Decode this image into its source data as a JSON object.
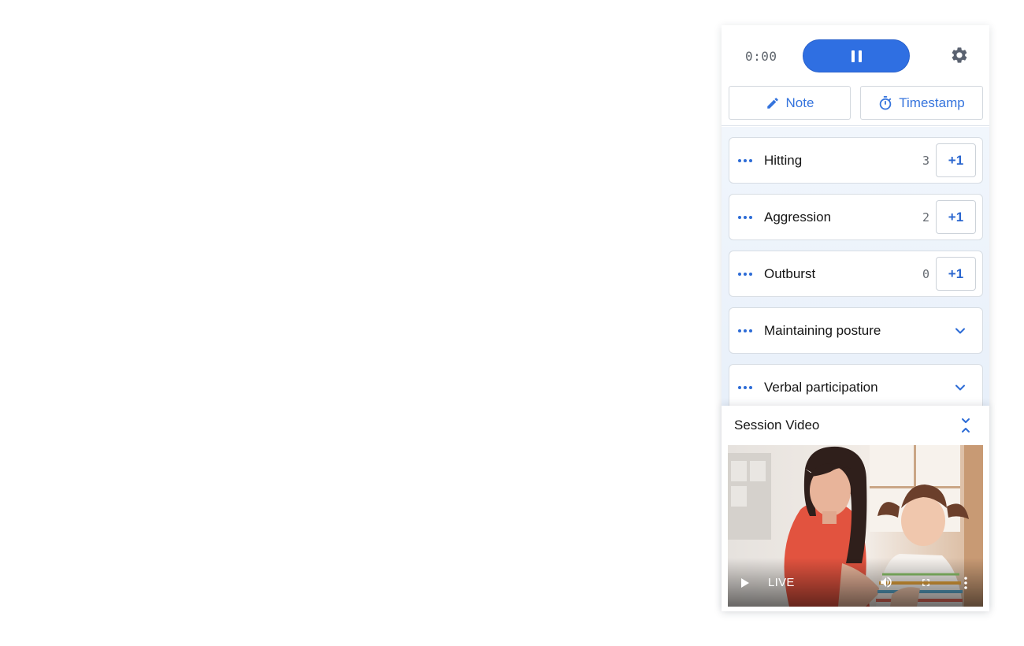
{
  "timer": {
    "elapsed": "0:00"
  },
  "toolbar": {
    "note_label": "Note",
    "timestamp_label": "Timestamp"
  },
  "behaviors": [
    {
      "label": "Hitting",
      "count": "3",
      "increment_label": "+1"
    },
    {
      "label": "Aggression",
      "count": "2",
      "increment_label": "+1"
    },
    {
      "label": "Outburst",
      "count": "0",
      "increment_label": "+1"
    },
    {
      "label": "Maintaining posture"
    },
    {
      "label": "Verbal participation"
    }
  ],
  "video": {
    "title": "Session Video",
    "status": "LIVE"
  },
  "icons": {
    "pause": "pause-icon",
    "settings": "gear-icon",
    "note": "pencil-icon",
    "timestamp": "stopwatch-icon",
    "more": "ellipsis-icon",
    "expand": "chevron-down-icon",
    "collapse": "collapse-icon",
    "play": "play-icon",
    "volume": "volume-icon",
    "fullscreen": "fullscreen-icon",
    "menu": "kebab-menu-icon"
  },
  "colors": {
    "accent": "#2f6fe2",
    "link": "#3574dd",
    "background": "#e8f0fa"
  }
}
